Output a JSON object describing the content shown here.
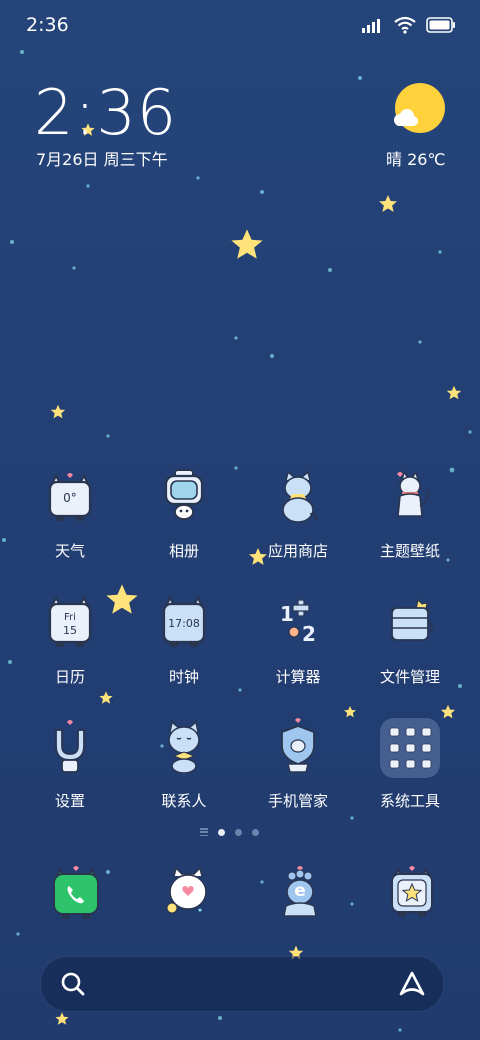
{
  "status_bar": {
    "time": "2:36"
  },
  "clock_widget": {
    "time": "2:36",
    "date": "7月26日 周三下午"
  },
  "weather_widget": {
    "text": "晴 26℃",
    "icon": "sunny-icon"
  },
  "apps": [
    {
      "id": "weather",
      "label": "天气",
      "icon": "weather-app-icon",
      "icon_text": "0°"
    },
    {
      "id": "gallery",
      "label": "相册",
      "icon": "gallery-app-icon"
    },
    {
      "id": "app-store",
      "label": "应用商店",
      "icon": "app-store-icon"
    },
    {
      "id": "themes",
      "label": "主题壁纸",
      "icon": "themes-icon"
    },
    {
      "id": "calendar",
      "label": "日历",
      "icon": "calendar-app-icon",
      "icon_text": "Fri",
      "icon_text2": "15"
    },
    {
      "id": "clock",
      "label": "时钟",
      "icon": "clock-app-icon",
      "icon_text": "17:08"
    },
    {
      "id": "calculator",
      "label": "计算器",
      "icon": "calculator-app-icon",
      "icon_text": "1",
      "icon_text2": "2"
    },
    {
      "id": "file-manager",
      "label": "文件管理",
      "icon": "file-manager-icon"
    },
    {
      "id": "settings",
      "label": "设置",
      "icon": "settings-app-icon"
    },
    {
      "id": "contacts",
      "label": "联系人",
      "icon": "contacts-app-icon"
    },
    {
      "id": "security",
      "label": "手机管家",
      "icon": "security-app-icon"
    },
    {
      "id": "system-tools",
      "label": "系统工具",
      "icon": "system-tools-folder-icon"
    }
  ],
  "dock": [
    {
      "id": "phone",
      "icon": "phone-app-icon"
    },
    {
      "id": "messages",
      "icon": "messages-app-icon"
    },
    {
      "id": "browser",
      "icon": "browser-app-icon",
      "icon_text": "e"
    },
    {
      "id": "dock-app-store",
      "icon": "favorites-app-icon"
    }
  ],
  "page_indicator": {
    "pages": 3,
    "current": 1
  },
  "colors": {
    "background": "#233f74",
    "star": "#ffe27a",
    "sun": "#ffd23c",
    "phone_green": "#2cc36b"
  }
}
